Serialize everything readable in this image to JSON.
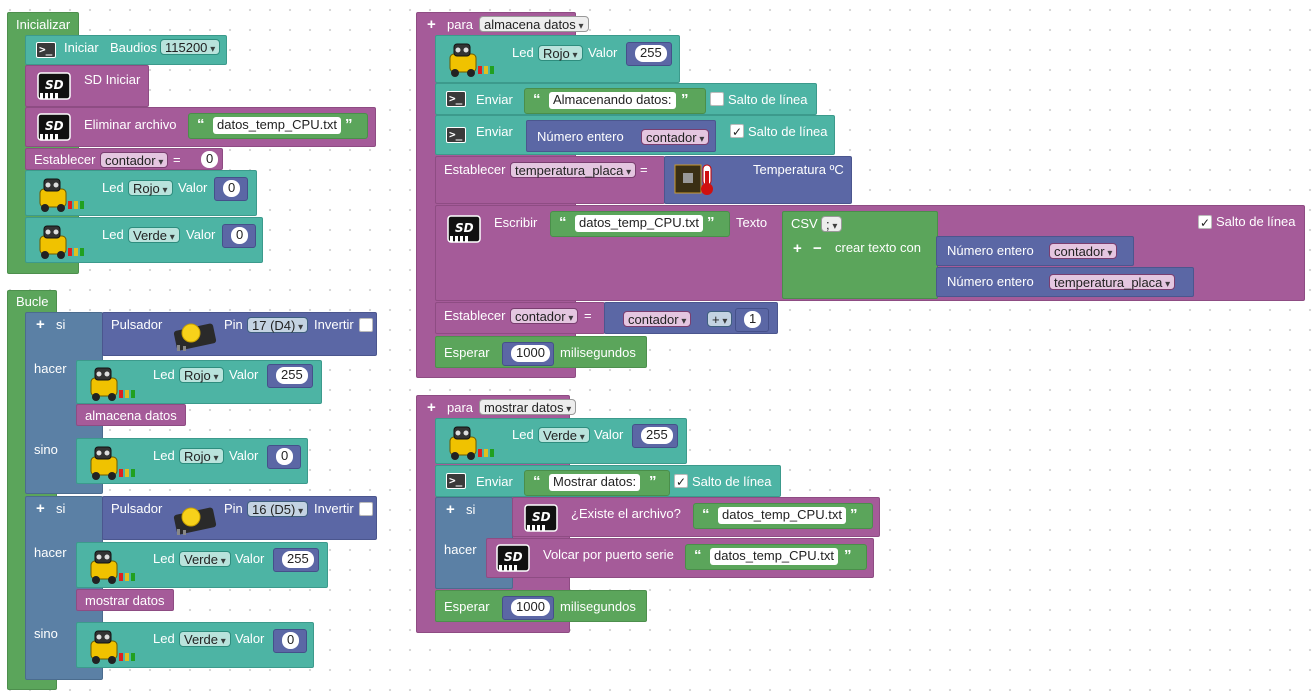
{
  "setup": {
    "title": "Inicializar",
    "serial_label": "Iniciar",
    "baud_label": "Baudios",
    "baud_value": "115200",
    "sd_init": "SD Iniciar",
    "delete_label": "Eliminar archivo",
    "delete_file": "datos_temp_CPU.txt",
    "set_label": "Establecer",
    "set_var": "contador",
    "set_eq": "=",
    "set_value": "0",
    "led1_label": "Led",
    "led1_color": "Rojo",
    "led1_val_label": "Valor",
    "led1_value": "0",
    "led2_label": "Led",
    "led2_color": "Verde",
    "led2_val_label": "Valor",
    "led2_value": "0"
  },
  "loop": {
    "title": "Bucle",
    "if1": "si",
    "btn1_label": "Pulsador",
    "pin_label": "Pin",
    "pin1": "17 (D4)",
    "invert_label": "Invertir",
    "do1": "hacer",
    "led_do1_label": "Led",
    "led_do1_color": "Rojo",
    "led_do1_val_label": "Valor",
    "led_do1_value": "255",
    "call1": "almacena datos",
    "else1": "sino",
    "led_else1_label": "Led",
    "led_else1_color": "Rojo",
    "led_else1_val_label": "Valor",
    "led_else1_value": "0",
    "if2": "si",
    "btn2_label": "Pulsador",
    "pin2": "16 (D5)",
    "do2": "hacer",
    "led_do2_label": "Led",
    "led_do2_color": "Verde",
    "led_do2_val_label": "Valor",
    "led_do2_value": "255",
    "call2": "mostrar datos",
    "else2": "sino",
    "led_else2_label": "Led",
    "led_else2_color": "Verde",
    "led_else2_val_label": "Valor",
    "led_else2_value": "0"
  },
  "fn1": {
    "para": "para",
    "name": "almacena datos",
    "led_label": "Led",
    "led_color": "Rojo",
    "led_val_label": "Valor",
    "led_value": "255",
    "send_label": "Enviar",
    "send_text": "Almacenando datos:",
    "newline_label": "Salto de línea",
    "send2_label": "Enviar",
    "int_label": "Número entero",
    "int_var": "contador",
    "newline2_label": "Salto de línea",
    "set_label": "Establecer",
    "set_var": "temperatura_placa",
    "set_eq": "=",
    "temp_label": "Temperatura ºC",
    "write_label": "Escribir",
    "write_file": "datos_temp_CPU.txt",
    "text_label": "Texto",
    "csv_label": "CSV",
    "csv_sep": ";",
    "newline3_label": "Salto de línea",
    "create_text": "crear texto con",
    "int2_label": "Número entero",
    "int2_var": "contador",
    "int3_label": "Número entero",
    "int3_var": "temperatura_placa",
    "set2_label": "Establecer",
    "set2_var": "contador",
    "set2_eq": "=",
    "add_var": "contador",
    "add_op": "+",
    "add_value": "1",
    "wait_label": "Esperar",
    "wait_value": "1000",
    "wait_unit": "milisegundos"
  },
  "fn2": {
    "para": "para",
    "name": "mostrar datos",
    "led_label": "Led",
    "led_color": "Verde",
    "led_val_label": "Valor",
    "led_value": "255",
    "send_label": "Enviar",
    "send_text": "Mostrar datos:",
    "newline_label": "Salto de línea",
    "if": "si",
    "exists_label": "¿Existe el archivo?",
    "exists_file": "datos_temp_CPU.txt",
    "do": "hacer",
    "dump_label": "Volcar por puerto serie",
    "dump_file": "datos_temp_CPU.txt",
    "wait_label": "Esperar",
    "wait_value": "1000",
    "wait_unit": "milisegundos"
  },
  "icons": {
    "checked": "✓",
    "plus": "+",
    "minus": "−",
    "quote_open": "“",
    "quote_close": "”"
  },
  "colors": {
    "setup_green": "#5ba55b",
    "procedure_purple": "#a55b99",
    "teal": "#4db4a4",
    "logic_blue": "#5b80a5",
    "number_indigo": "#5b67a5"
  }
}
